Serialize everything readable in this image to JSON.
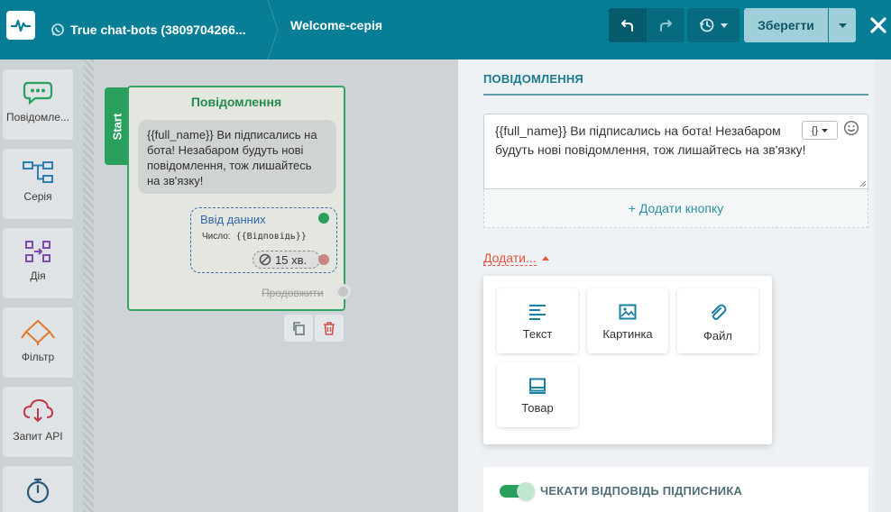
{
  "topbar": {
    "bot_name": "True chat-bots (3809704266...",
    "flow_name": "Welcome-серія",
    "save_label": "Зберегти",
    "colors": {
      "bar": "#087d96",
      "save": "#9fcfd9"
    }
  },
  "sidebar": {
    "items": [
      {
        "label": "Повідомле...",
        "icon": "chat-bubble-icon"
      },
      {
        "label": "Серія",
        "icon": "flow-chart-icon"
      },
      {
        "label": "Дія",
        "icon": "action-icon"
      },
      {
        "label": "Фільтр",
        "icon": "filter-icon"
      },
      {
        "label": "Запит API",
        "icon": "cloud-api-icon"
      },
      {
        "label": "",
        "icon": "stopwatch-icon"
      }
    ]
  },
  "node": {
    "start_label": "Start",
    "title": "Повідомлення",
    "message": "{{full_name}} Ви підписались на бота! Незабаром будуть нові повідомлення, тож лишайтесь на зв'язку!",
    "input_title": "Ввід данних",
    "input_sub_label": "Число:",
    "input_sub_var": "{{Відповідь}}",
    "timer": "15 хв.",
    "continue_label": "Продовжити"
  },
  "panel": {
    "section_title": "ПОВІДОМЛЕННЯ",
    "message": "{{full_name}} Ви підписались на бота! Незабаром будуть нові повідомлення, тож лишайтесь на зв'язку!",
    "var_button": "{}",
    "add_button": "+ Додати кнопку",
    "add_menu_label": "Додати...",
    "tiles": [
      {
        "label": "Текст",
        "icon": "text-icon"
      },
      {
        "label": "Картинка",
        "icon": "image-icon"
      },
      {
        "label": "Файл",
        "icon": "paperclip-icon"
      },
      {
        "label": "Товар",
        "icon": "product-icon"
      }
    ],
    "wait_reply_label": "ЧЕКАТИ ВІДПОВІДЬ ПІДПИСНИКА",
    "wait_reply_enabled": true
  }
}
